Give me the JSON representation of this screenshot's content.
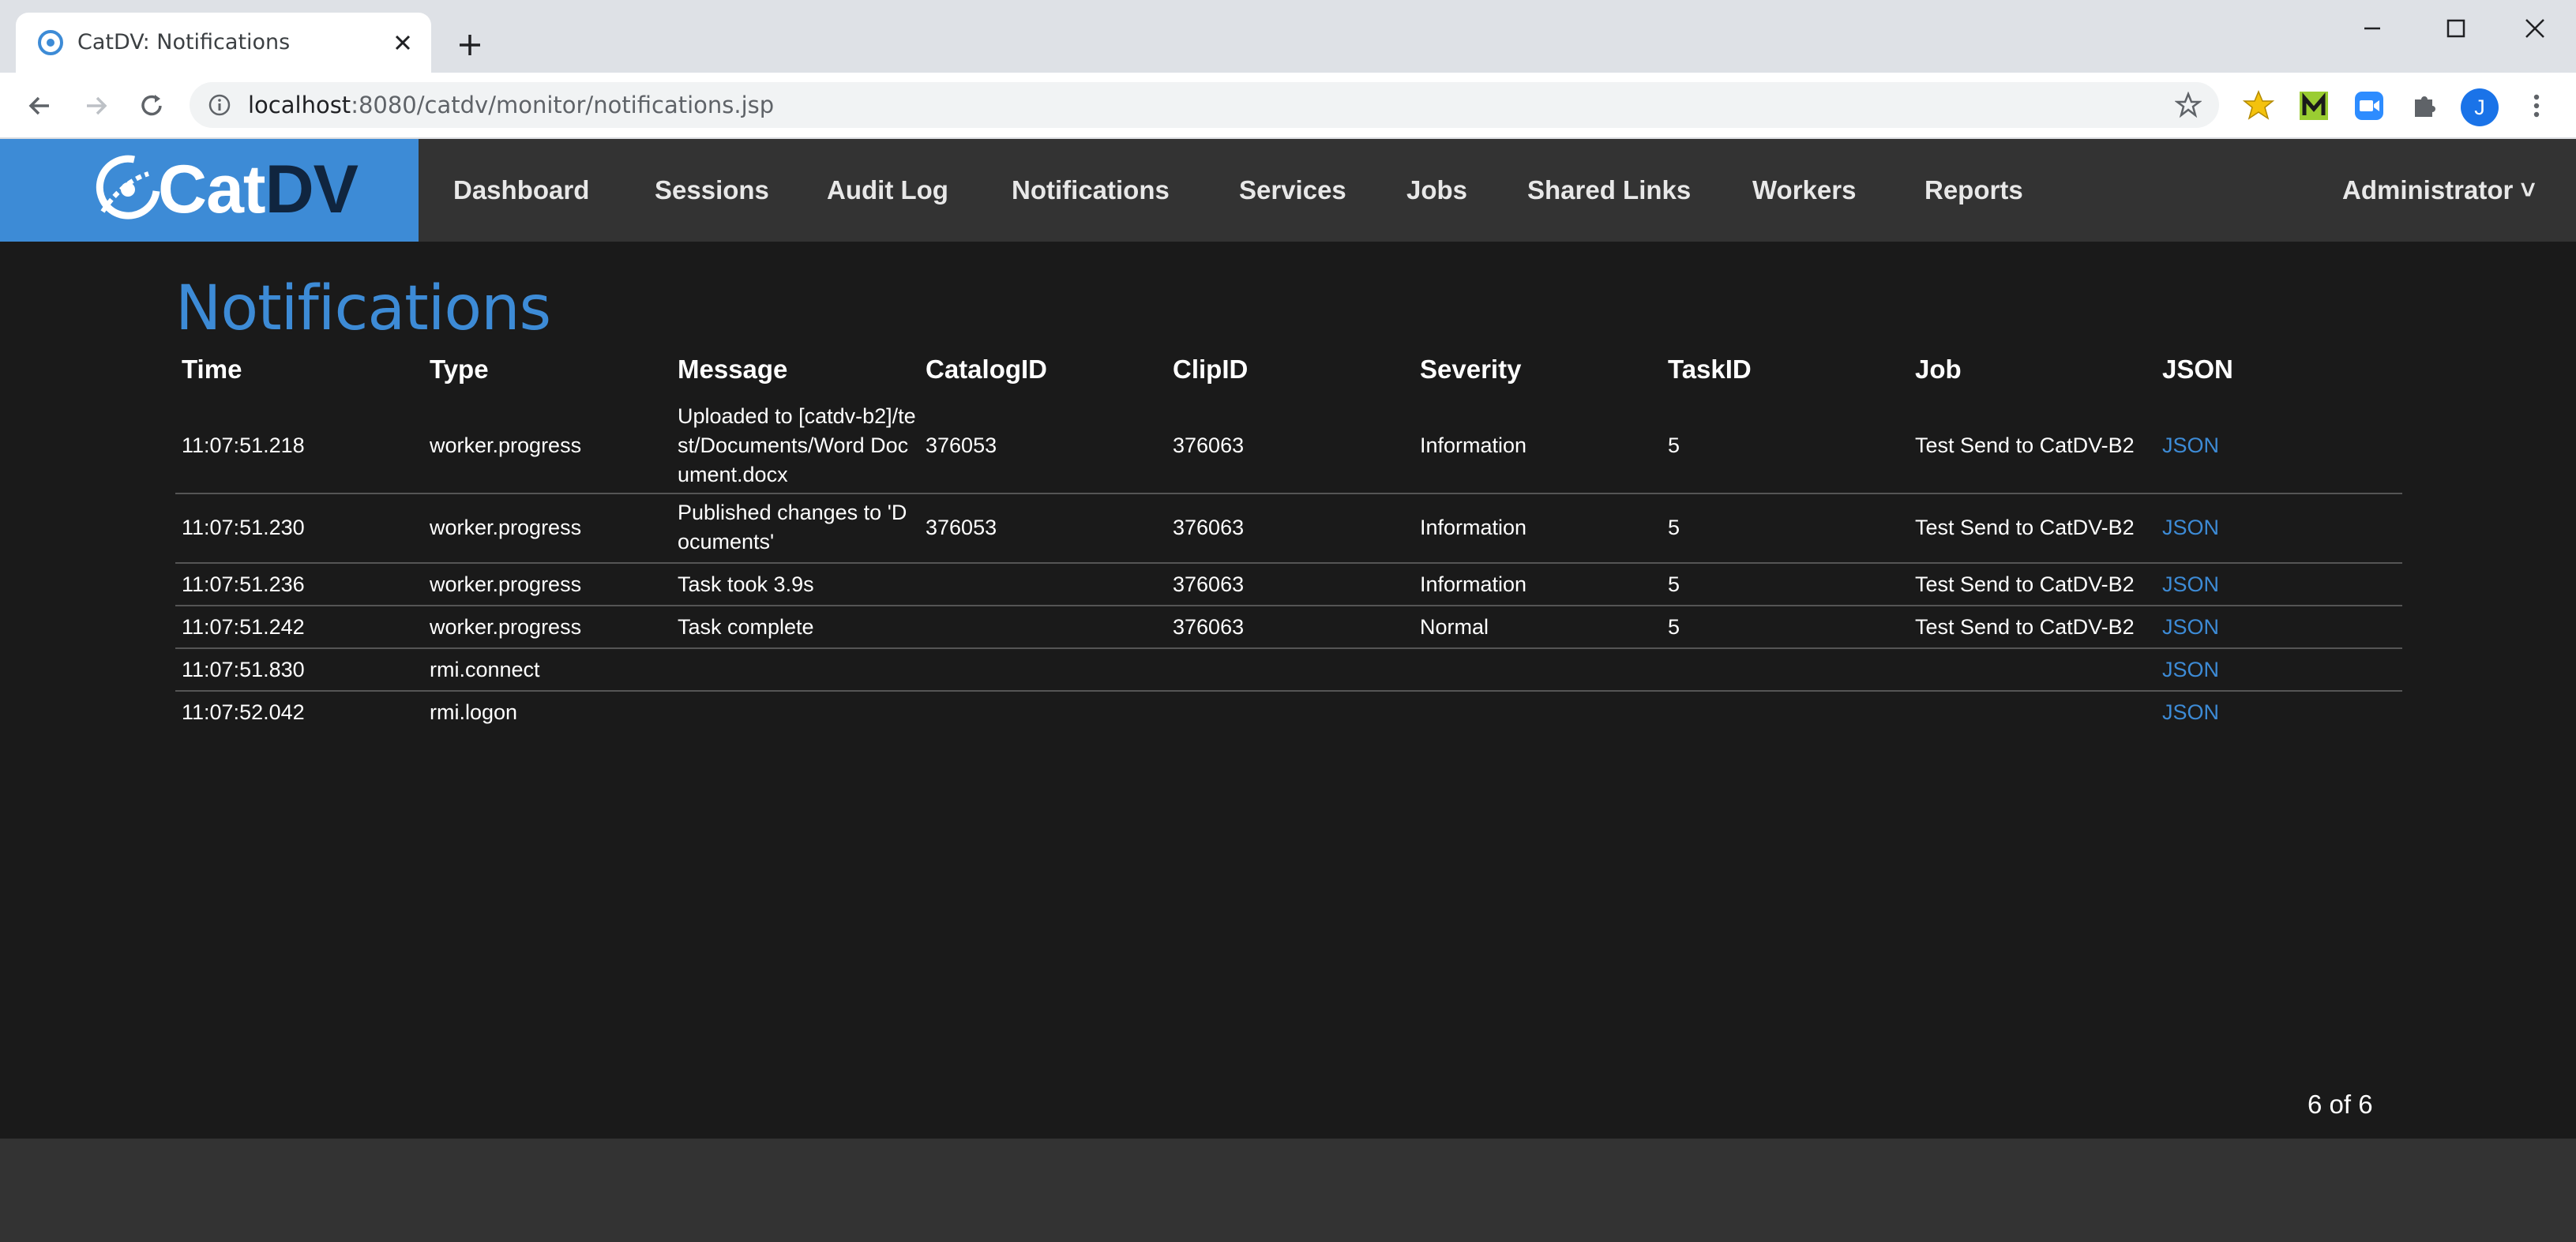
{
  "browser": {
    "tab_title": "CatDV: Notifications",
    "url_host": "localhost",
    "url_rest": ":8080/catdv/monitor/notifications.jsp",
    "avatar_letter": "J"
  },
  "app": {
    "logo_main": "Cat",
    "logo_accent": "DV",
    "nav": [
      "Dashboard",
      "Sessions",
      "Audit Log",
      "Notifications",
      "Services",
      "Jobs",
      "Shared Links",
      "Workers",
      "Reports"
    ],
    "user_menu": "Administrator ˅"
  },
  "page": {
    "title": "Notifications",
    "columns": [
      "Time",
      "Type",
      "Message",
      "CatalogID",
      "ClipID",
      "Severity",
      "TaskID",
      "Job",
      "JSON"
    ],
    "rows": [
      [
        "11:07:51.218",
        "worker.progress",
        "Uploaded to [catdv-b2]/test/Documents/Word Document.docx",
        "376053",
        "376063",
        "Information",
        "5",
        "Test Send to CatDV-B2",
        "JSON"
      ],
      [
        "11:07:51.230",
        "worker.progress",
        "Published changes to 'Documents'",
        "376053",
        "376063",
        "Information",
        "5",
        "Test Send to CatDV-B2",
        "JSON"
      ],
      [
        "11:07:51.236",
        "worker.progress",
        "Task took 3.9s",
        "",
        "376063",
        "Information",
        "5",
        "Test Send to CatDV-B2",
        "JSON"
      ],
      [
        "11:07:51.242",
        "worker.progress",
        "Task complete",
        "",
        "376063",
        "Normal",
        "5",
        "Test Send to CatDV-B2",
        "JSON"
      ],
      [
        "11:07:51.830",
        "rmi.connect",
        "",
        "",
        "",
        "",
        "",
        "",
        "JSON"
      ],
      [
        "11:07:52.042",
        "rmi.logon",
        "",
        "",
        "",
        "",
        "",
        "",
        "JSON"
      ]
    ],
    "count_text": "6 of 6"
  },
  "colors": {
    "accent": "#3d8bd6",
    "nav_bg": "#333333",
    "page_bg": "#1a1a1a"
  }
}
